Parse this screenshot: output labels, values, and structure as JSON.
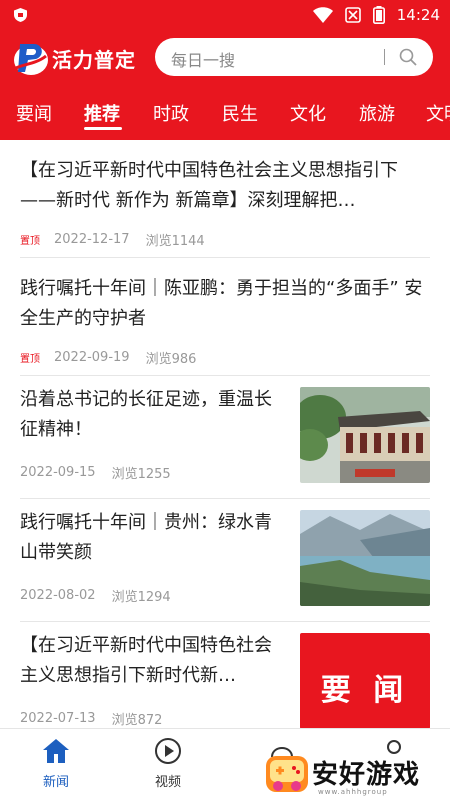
{
  "status_bar": {
    "time": "14:24",
    "icons": [
      "shield-icon",
      "wifi-icon",
      "no-sim-icon",
      "battery-icon"
    ]
  },
  "header": {
    "app_name": "活力普定",
    "search_placeholder": "每日一搜",
    "brand_color": "#e8161f"
  },
  "tabs": [
    {
      "label": "要闻",
      "active": false
    },
    {
      "label": "推荐",
      "active": true
    },
    {
      "label": "时政",
      "active": false
    },
    {
      "label": "民生",
      "active": false
    },
    {
      "label": "文化",
      "active": false
    },
    {
      "label": "旅游",
      "active": false
    },
    {
      "label": "文明",
      "active": false
    }
  ],
  "news": [
    {
      "title": "【在习近平新时代中国特色社会主义思想指引下——新时代 新作为 新篇章】深刻理解把…",
      "pinned": "置顶",
      "date": "2022-12-17",
      "views": "浏览1144"
    },
    {
      "title": "践行嘱托十年间｜陈亚鹏：勇于担当的“多面手” 安全生产的守护者",
      "pinned": "置顶",
      "date": "2022-09-19",
      "views": "浏览986"
    },
    {
      "title": "沿着总书记的长征足迹，重温长征精神！",
      "date": "2022-09-15",
      "views": "浏览1255",
      "thumb": "historic-building-photo"
    },
    {
      "title": "践行嘱托十年间｜贵州：绿水青山带笑颜",
      "date": "2022-08-02",
      "views": "浏览1294",
      "thumb": "river-valley-photo"
    },
    {
      "title": "【在习近平新时代中国特色社会主义思想指引下新时代新…",
      "date": "2022-07-13",
      "views": "浏览872",
      "thumb_text": "要 闻"
    }
  ],
  "bottom_nav": [
    {
      "label": "新闻",
      "icon": "home-icon",
      "active": true
    },
    {
      "label": "视频",
      "icon": "play-icon",
      "active": false
    }
  ],
  "watermark": {
    "text": "安好游戏",
    "sub": "www.ahhhgroup"
  }
}
